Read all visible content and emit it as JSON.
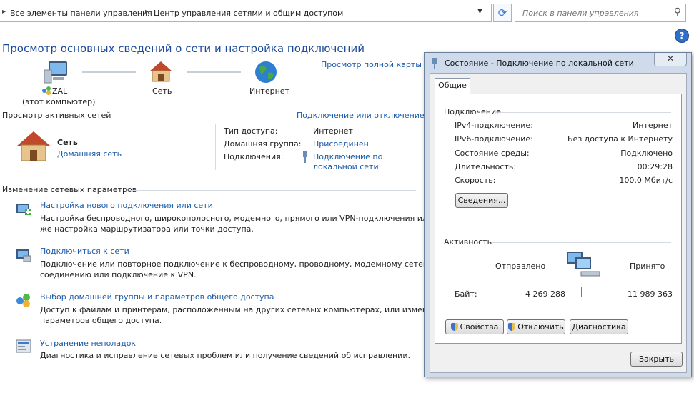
{
  "address_bar": {
    "crumbs": [
      "Все элементы панели управления",
      "Центр управления сетями и общим доступом"
    ]
  },
  "search": {
    "placeholder": "Поиск в панели управления"
  },
  "main": {
    "title": "Просмотр основных сведений о сети и настройка подключений",
    "full_map_link": "Просмотр полной карты",
    "map": {
      "computer_name": "ZAL",
      "computer_sub": "(этот компьютер)",
      "network_label": "Сеть",
      "internet_label": "Интернет"
    },
    "active_networks": {
      "header": "Просмотр активных сетей",
      "connect_link": "Подключение или отключение",
      "network_name": "Сеть",
      "network_type": "Домашняя сеть",
      "access_type_label": "Тип доступа:",
      "access_type_value": "Интернет",
      "homegroup_label": "Домашняя группа:",
      "homegroup_value": "Присоединен",
      "connections_label": "Подключения:",
      "connection_value_line1": "Подключение по",
      "connection_value_line2": "локальной сети"
    },
    "change_settings": {
      "header": "Изменение сетевых параметров",
      "tasks": [
        {
          "title": "Настройка нового подключения или сети",
          "desc1": "Настройка беспроводного, широкополосного, модемного, прямого или VPN-подключения или",
          "desc2": "же настройка маршрутизатора или точки доступа."
        },
        {
          "title": "Подключиться к сети",
          "desc1": "Подключение или повторное подключение к беспроводному, проводному, модемному сетевому",
          "desc2": "соединению или подключение к VPN."
        },
        {
          "title": "Выбор домашней группы и параметров общего доступа",
          "desc1": "Доступ к файлам и принтерам, расположенным на других сетевых компьютерах, или изменение",
          "desc2": "параметров общего доступа."
        },
        {
          "title": "Устранение неполадок",
          "desc1": "Диагностика и исправление сетевых проблем или получение сведений об исправлении.",
          "desc2": ""
        }
      ]
    }
  },
  "dialog": {
    "title": "Состояние - Подключение по локальной сети",
    "tab": "Общие",
    "connection_group": "Подключение",
    "rows": [
      {
        "label": "IPv4-подключение:",
        "value": "Интернет"
      },
      {
        "label": "IPv6-подключение:",
        "value": "Без доступа к Интернету"
      },
      {
        "label": "Состояние среды:",
        "value": "Подключено"
      },
      {
        "label": "Длительность:",
        "value": "00:29:28"
      },
      {
        "label": "Скорость:",
        "value": "100.0 Мбит/с"
      }
    ],
    "details_button": "Сведения...",
    "activity_group": "Активность",
    "sent_label": "Отправлено",
    "received_label": "Принято",
    "bytes_label": "Байт:",
    "bytes_sent": "4 269 288",
    "bytes_received": "11 989 363",
    "properties_button": "Свойства",
    "disable_button": "Отключить",
    "diagnose_button": "Диагностика",
    "close_button": "Закрыть"
  }
}
